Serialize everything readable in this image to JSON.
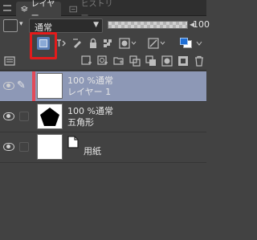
{
  "tabs": [
    {
      "label": "レイヤー",
      "icon": "layers-icon",
      "active": true
    },
    {
      "label": "ヒストリー",
      "icon": "history-icon",
      "active": false
    }
  ],
  "blend": {
    "mode": "通常",
    "opacity_value": "100",
    "opacity_percent": 100
  },
  "toolbar_row1": {
    "clip_icon": "clip-to-layer-below-icon",
    "icons": [
      "reference-layer-icon",
      "draft-layer-icon",
      "lock-icon",
      "lock-transparent-icon",
      "mask-icon",
      "ruler-icon",
      "layer-color-icon"
    ]
  },
  "toolbar_row2": {
    "icons": [
      "panel-menu-icon",
      "new-raster-layer-icon",
      "new-vector-layer-icon",
      "new-folder-icon",
      "transfer-down-icon",
      "combine-icon",
      "mask-create-icon",
      "apply-mask-icon",
      "delete-layer-icon"
    ]
  },
  "layers": [
    {
      "blend": "100 %通常",
      "name": "レイヤー 1",
      "selected": true,
      "thumb": "blank"
    },
    {
      "blend": "100 %通常",
      "name": "五角形",
      "selected": false,
      "thumb": "pentagon"
    },
    {
      "blend": "",
      "name": "用紙",
      "selected": false,
      "thumb": "paper"
    }
  ],
  "colors": {
    "accent": "#e31b1b",
    "selected_row": "#8d98b6",
    "swatch_front": "#1f6fd6"
  }
}
